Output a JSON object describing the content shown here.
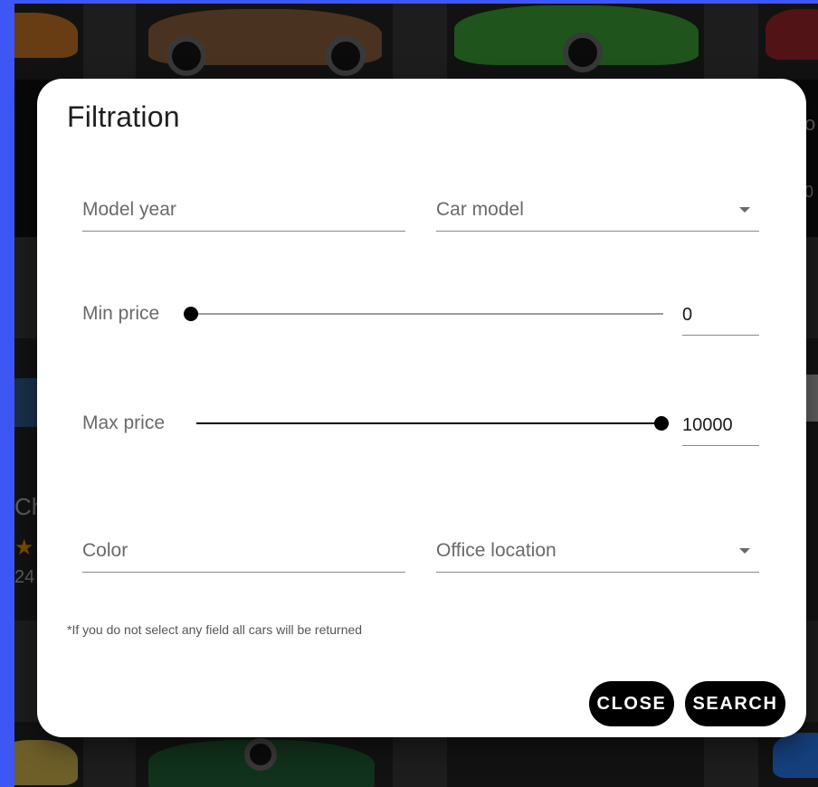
{
  "dialog": {
    "title": "Filtration",
    "fields": {
      "model_year": {
        "label": "Model year"
      },
      "car_model": {
        "label": "Car model"
      },
      "color": {
        "label": "Color"
      },
      "office_location": {
        "label": "Office location"
      }
    },
    "min_price": {
      "label": "Min price",
      "value": "0",
      "fraction": 0.0
    },
    "max_price": {
      "label": "Max price",
      "value": "10000",
      "fraction": 1.0
    },
    "note": "*If you do not select any field all cars will be returned",
    "buttons": {
      "close": "CLOSE",
      "search": "SEARCH"
    }
  },
  "background": {
    "partial_texts": {
      "name": "Ch",
      "price": "24",
      "edge_top": "o",
      "edge_top_2": "0"
    }
  },
  "colors": {
    "frame": "#3d57f5",
    "accent": "#000000",
    "slider_track_inactive": "#9e9e9e"
  }
}
